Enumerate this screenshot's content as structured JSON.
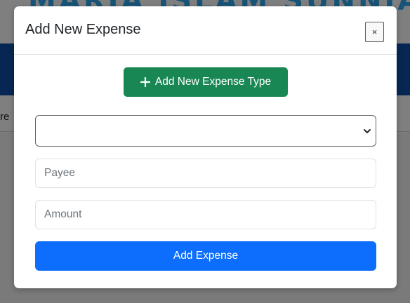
{
  "background": {
    "banner_title": "MARIA ISLAM SUNNIA",
    "tab_fragment": "re"
  },
  "modal": {
    "title": "Add New Expense",
    "close_label": "×",
    "add_type_button": {
      "icon": "plus-icon",
      "label": "Add New Expense Type"
    },
    "expense_type_select": {
      "selected_value": "",
      "icon": "chevron-down-icon"
    },
    "payee_field": {
      "value": "",
      "placeholder": "Payee"
    },
    "amount_field": {
      "value": "",
      "placeholder": "Amount"
    },
    "submit_label": "Add Expense"
  },
  "colors": {
    "success": "#198754",
    "primary": "#0d6efd",
    "navbar": "#0d4ea6",
    "banner_text": "#2ea8f0"
  }
}
